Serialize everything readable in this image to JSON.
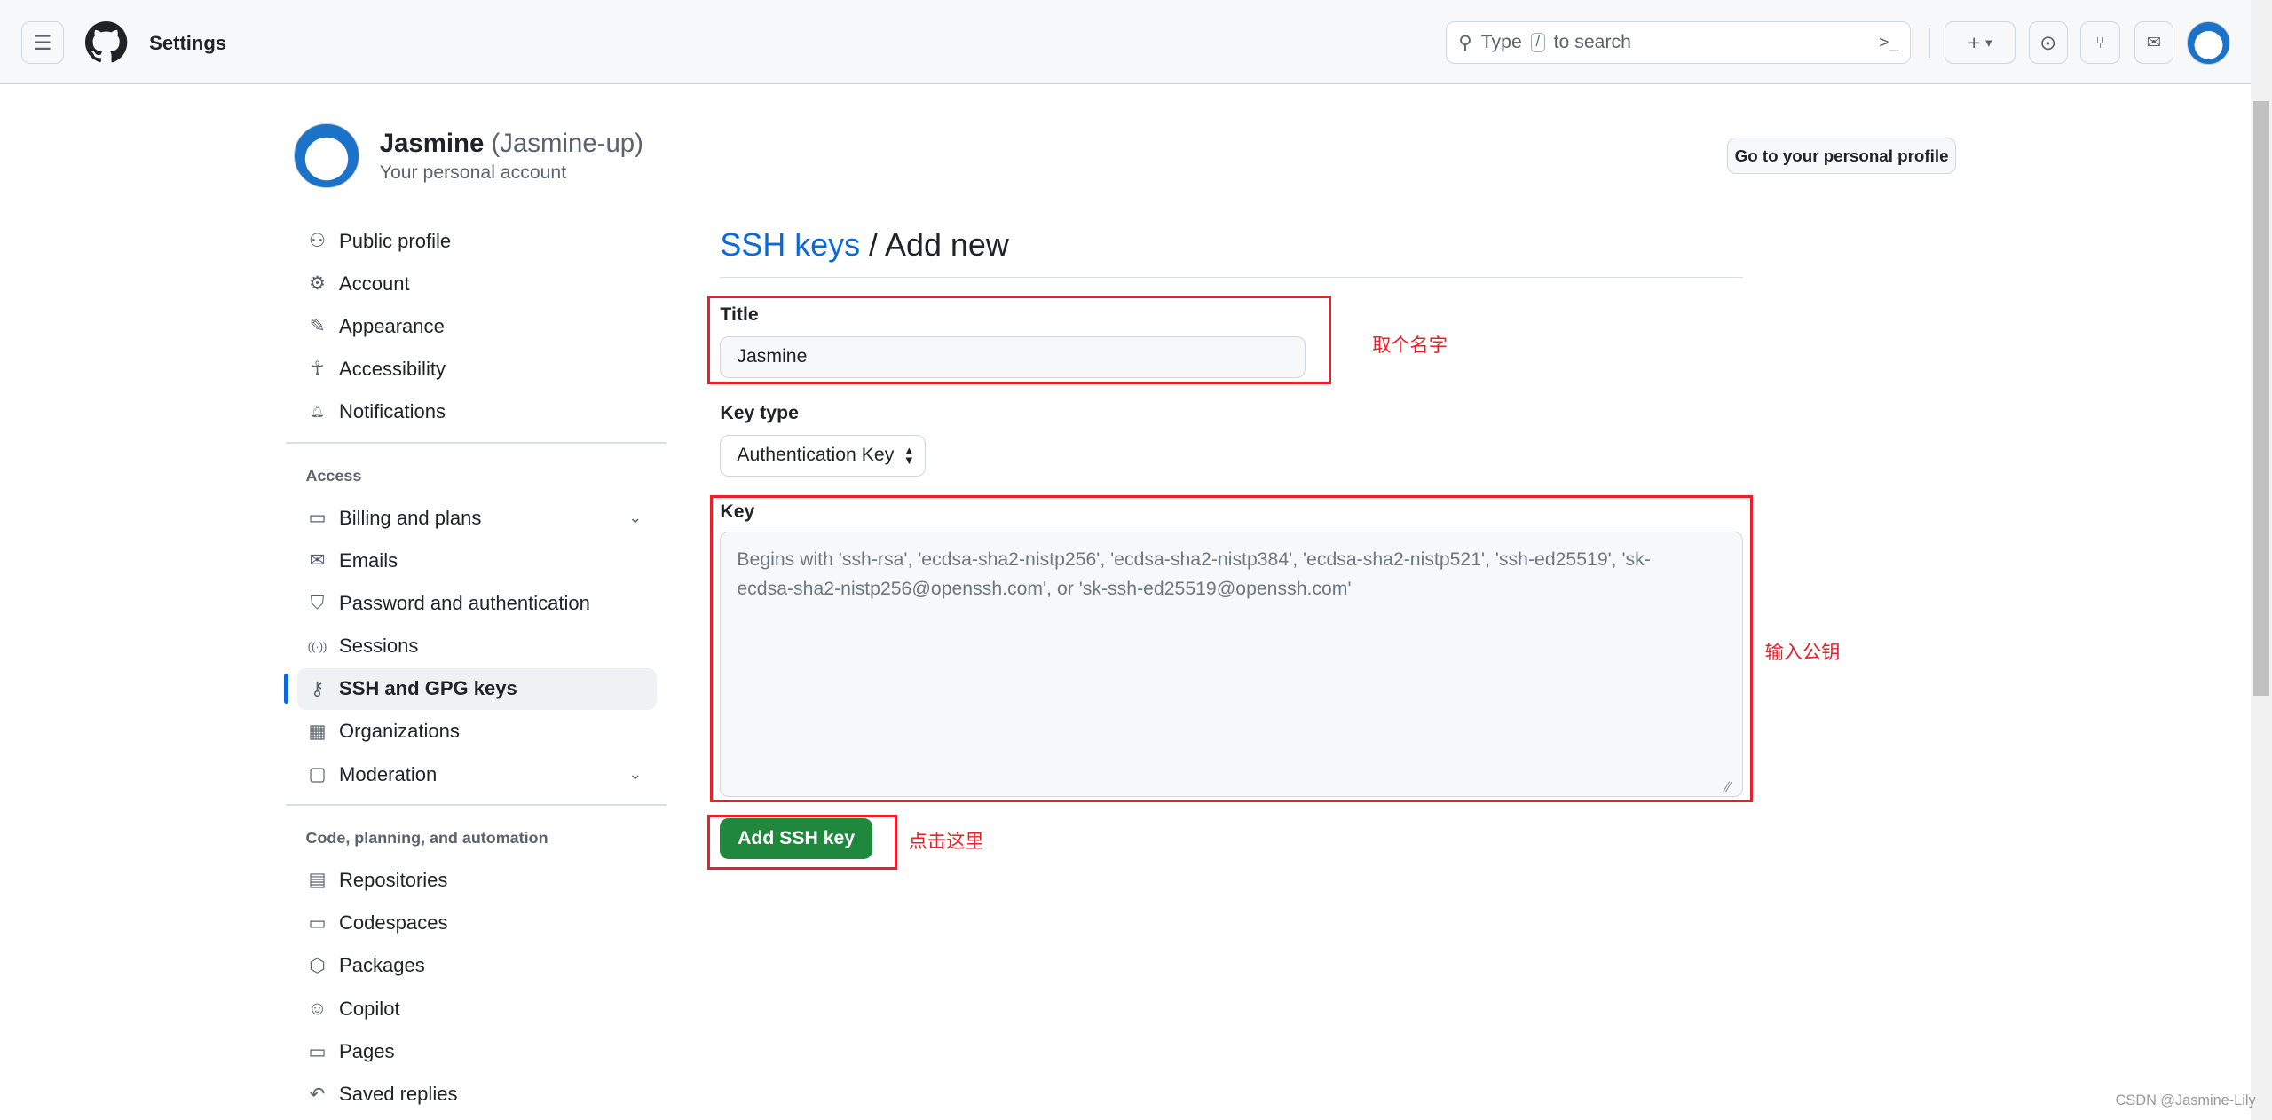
{
  "header": {
    "title": "Settings",
    "search_placeholder_pre": "Type",
    "search_key": "/",
    "search_placeholder_post": "to search",
    "new_label": "+"
  },
  "user": {
    "name": "Jasmine",
    "login": "(Jasmine-up)",
    "subtitle": "Your personal account",
    "profile_button": "Go to your personal profile"
  },
  "sidebar": {
    "items": [
      {
        "label": "Public profile",
        "icon": "person-icon"
      },
      {
        "label": "Account",
        "icon": "gear-icon"
      },
      {
        "label": "Appearance",
        "icon": "paintbrush-icon"
      },
      {
        "label": "Accessibility",
        "icon": "accessibility-icon"
      },
      {
        "label": "Notifications",
        "icon": "bell-icon"
      }
    ],
    "access_heading": "Access",
    "access_items": [
      {
        "label": "Billing and plans",
        "icon": "credit-card-icon"
      },
      {
        "label": "Emails",
        "icon": "mail-icon"
      },
      {
        "label": "Password and authentication",
        "icon": "shield-lock-icon"
      },
      {
        "label": "Sessions",
        "icon": "broadcast-icon"
      },
      {
        "label": "SSH and GPG keys",
        "icon": "key-icon",
        "selected": true
      },
      {
        "label": "Organizations",
        "icon": "organization-icon"
      },
      {
        "label": "Moderation",
        "icon": "report-icon"
      }
    ],
    "code_heading": "Code, planning, and automation",
    "code_items": [
      {
        "label": "Repositories",
        "icon": "repo-icon"
      },
      {
        "label": "Codespaces",
        "icon": "codespaces-icon"
      },
      {
        "label": "Packages",
        "icon": "package-icon"
      },
      {
        "label": "Copilot",
        "icon": "copilot-icon"
      },
      {
        "label": "Pages",
        "icon": "browser-icon"
      },
      {
        "label": "Saved replies",
        "icon": "reply-icon"
      }
    ]
  },
  "main": {
    "breadcrumb_link": "SSH keys",
    "breadcrumb_sep": "/",
    "breadcrumb_current": "Add new",
    "title_label": "Title",
    "title_value": "Jasmine",
    "key_type_label": "Key type",
    "key_type_value": "Authentication Key",
    "key_label": "Key",
    "key_placeholder": "Begins with 'ssh-rsa', 'ecdsa-sha2-nistp256', 'ecdsa-sha2-nistp384', 'ecdsa-sha2-nistp521', 'ssh-ed25519', 'sk-ecdsa-sha2-nistp256@openssh.com', or 'sk-ssh-ed25519@openssh.com'",
    "submit": "Add SSH key"
  },
  "annotations": {
    "title_note": "取个名字",
    "key_note": "输入公钥",
    "submit_note": "点击这里"
  },
  "watermark": "CSDN @Jasmine-Lily",
  "colors": {
    "accent": "#0969da",
    "primary_button": "#1f883d",
    "annotation": "#e8202a"
  }
}
